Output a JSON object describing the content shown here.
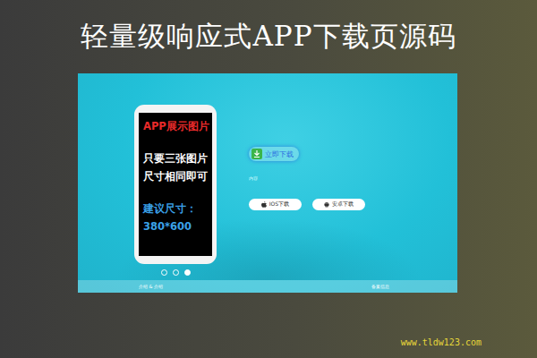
{
  "title": "轻量级响应式APP下载页源码",
  "preview": {
    "phone_lines": [
      {
        "text": "APP展示图片",
        "color": "#e82a2a"
      },
      {
        "text": "只要三张图片",
        "color": "#ffffff"
      },
      {
        "text": "尺寸相同即可",
        "color": "#ffffff"
      },
      {
        "text": "建议尺寸：",
        "color": "#3aa0e8"
      },
      {
        "text": "380*600",
        "color": "#3aa0e8"
      }
    ],
    "dots": [
      {
        "selected": false
      },
      {
        "selected": false
      },
      {
        "selected": true
      }
    ],
    "download_badge": "立即下载",
    "intro": "内容",
    "buttons": [
      {
        "label": "IOS下载",
        "kind": "ios"
      },
      {
        "label": "安卓下载",
        "kind": "android"
      }
    ],
    "footer": {
      "left": "介绍 & 介绍",
      "right": "备案信息"
    }
  },
  "watermark": "www.tldw123.com"
}
